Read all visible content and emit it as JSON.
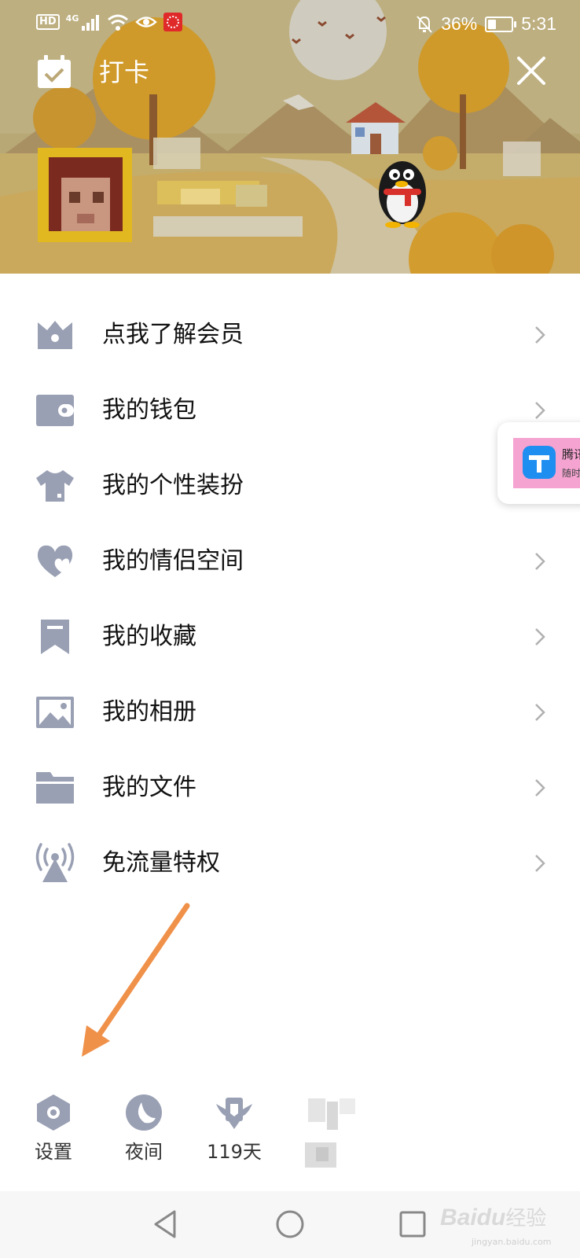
{
  "status_bar": {
    "hd_label": "HD",
    "network_label": "4G",
    "battery_percent": "36%",
    "battery_level": 0.36,
    "time": "5:31"
  },
  "header": {
    "checkin_label": "打卡",
    "checkin_icon": "calendar-check-icon",
    "close_icon": "close-icon",
    "pet_icon": "penguin-icon"
  },
  "menu": {
    "items": [
      {
        "label": "点我了解会员",
        "icon": "crown-icon"
      },
      {
        "label": "我的钱包",
        "icon": "wallet-icon"
      },
      {
        "label": "我的个性装扮",
        "icon": "shirt-icon"
      },
      {
        "label": "我的情侣空间",
        "icon": "hearts-icon"
      },
      {
        "label": "我的收藏",
        "icon": "bookmark-icon"
      },
      {
        "label": "我的相册",
        "icon": "photo-icon"
      },
      {
        "label": "我的文件",
        "icon": "folder-icon"
      },
      {
        "label": "免流量特权",
        "icon": "signal-tower-icon"
      }
    ]
  },
  "ad": {
    "title": "腾讯",
    "subtitle": "随时"
  },
  "toolbar": {
    "settings_label": "设置",
    "night_label": "夜间",
    "days_label": "119天"
  },
  "navbar": {
    "watermark": "Baidu",
    "watermark_cn": "经验",
    "watermark_url": "jingyan.baidu.com"
  },
  "colors": {
    "icon_gray": "#9aa0b4",
    "banner_sky": "#bfae82",
    "annotation_arrow": "#f0914a",
    "sun": "#ccc9bd"
  }
}
